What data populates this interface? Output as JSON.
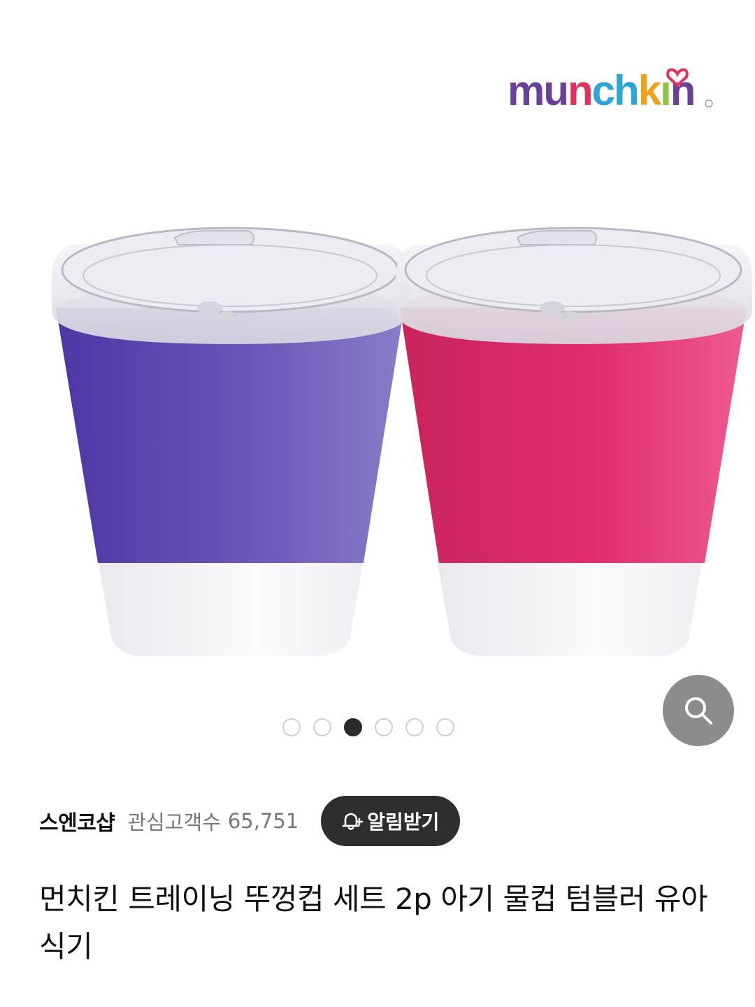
{
  "brand": {
    "logo_text": "munchkin",
    "colors": {
      "m": "#6a3f9c",
      "u": "#6a3f9c",
      "n1": "#e0325f",
      "c": "#2aa7d6",
      "h": "#2aa7d6",
      "k": "#f2a21a",
      "i": "#8cc63f",
      "n2": "#6a3f9c"
    }
  },
  "hero": {
    "product_image": {
      "left_cup_color": "#6a57b8",
      "right_cup_color": "#e23a7c",
      "lid": "clear",
      "base": "white"
    },
    "zoom_icon": "search-icon",
    "carousel": {
      "total": 6,
      "active_index": 2
    }
  },
  "store": {
    "name": "스엔코샵",
    "follower_label": "관심고객수",
    "follower_count": "65,751",
    "alert_button_label": "알림받기",
    "alert_icon": "bell-plus-icon"
  },
  "product": {
    "title": "먼치킨 트레이닝 뚜껑컵 세트 2p 아기 물컵 텀블러 유아 식기"
  }
}
